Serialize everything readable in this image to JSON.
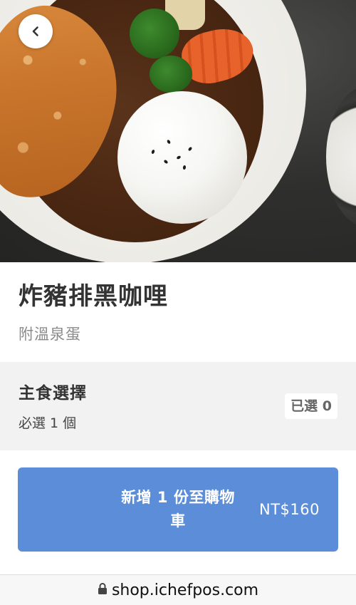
{
  "hero": {
    "image": "pork-cutlet-black-curry-photo",
    "back_icon": "chevron-left-icon"
  },
  "product": {
    "name": "炸豬排黑咖哩",
    "description": "附溫泉蛋"
  },
  "option_group": {
    "title": "主食選擇",
    "rule": "必選 1 個",
    "selected_count": "已選 0"
  },
  "cart": {
    "button_label": "新增 1 份至購物車",
    "price": "NT$160",
    "color": "#5b8dd8"
  },
  "browser": {
    "url": "shop.ichefpos.com",
    "lock_icon": "lock-icon"
  }
}
